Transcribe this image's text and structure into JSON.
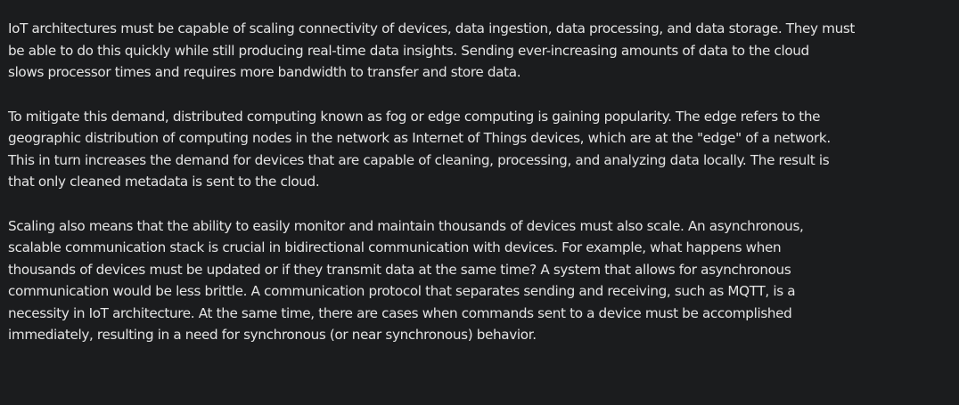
{
  "article": {
    "paragraphs": [
      {
        "lines": [
          "IoT architectures must be capable of scaling connectivity of devices, data ingestion, data processing, and data storage. They must",
          "be able to do this quickly while still producing real-time data insights. Sending ever-increasing amounts of data to the cloud",
          "slows processor times and requires more bandwidth to transfer and store data."
        ]
      },
      {
        "lines": [
          "To mitigate this demand, distributed computing known as fog or edge computing is gaining popularity. The edge refers to the",
          "geographic distribution of computing nodes in the network as Internet of Things devices, which are at the \"edge\" of a network.",
          "This in turn increases the demand for devices that are capable of cleaning, processing, and analyzing data locally. The result is",
          "that only cleaned metadata is sent to the cloud."
        ]
      },
      {
        "lines": [
          "Scaling also means that the ability to easily monitor and maintain thousands of devices must also scale. An asynchronous,",
          "scalable communication stack is crucial in bidirectional communication with devices. For example, what happens when",
          "thousands of devices must be updated or if they transmit data at the same time? A system that allows for asynchronous",
          "communication would be less brittle. A communication protocol that separates sending and receiving, such as MQTT, is a",
          "necessity in IoT architecture. At the same time, there are cases when commands sent to a device must be accomplished",
          "immediately, resulting in a need for synchronous (or near synchronous) behavior."
        ]
      }
    ]
  },
  "colors": {
    "background": "#1b1c1e",
    "text": "#e4e4e4"
  }
}
